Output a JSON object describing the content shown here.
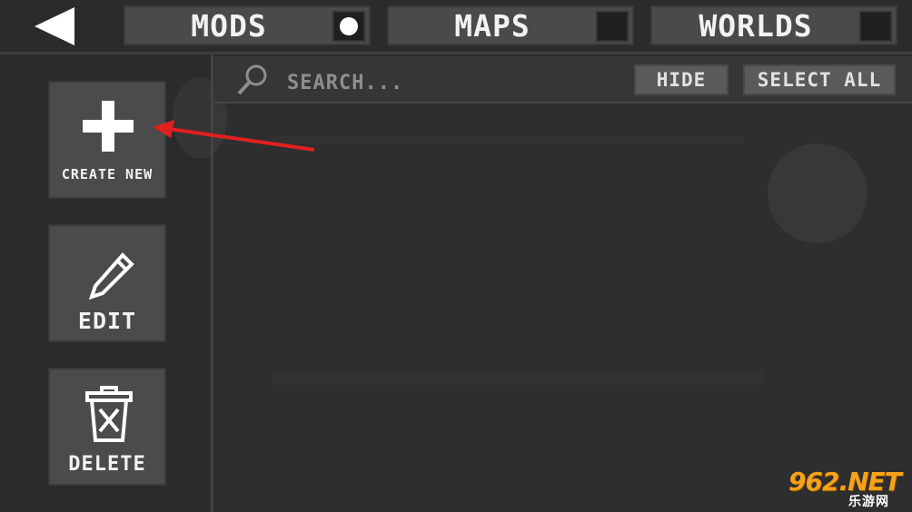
{
  "topbar": {
    "tabs": [
      {
        "label": "MODS",
        "selected": true
      },
      {
        "label": "MAPS",
        "selected": false
      },
      {
        "label": "WORLDS",
        "selected": false
      }
    ]
  },
  "sidebar": {
    "create_label": "CREATE NEW",
    "edit_label": "EDIT",
    "delete_label": "DELETE"
  },
  "search": {
    "placeholder": "SEARCH...",
    "hide_label": "HIDE",
    "select_all_label": "SELECT ALL"
  },
  "watermark": {
    "main": "962.NET",
    "sub": "乐游网"
  },
  "colors": {
    "background": "#2b2b2b",
    "button": "#4b4b4b",
    "annotation_arrow": "#e02020",
    "watermark": "#f6a21b"
  },
  "icons": {
    "back": "back-triangle-icon",
    "create": "plus-icon",
    "edit": "pencil-icon",
    "delete": "trash-icon",
    "search": "magnifier-icon"
  }
}
